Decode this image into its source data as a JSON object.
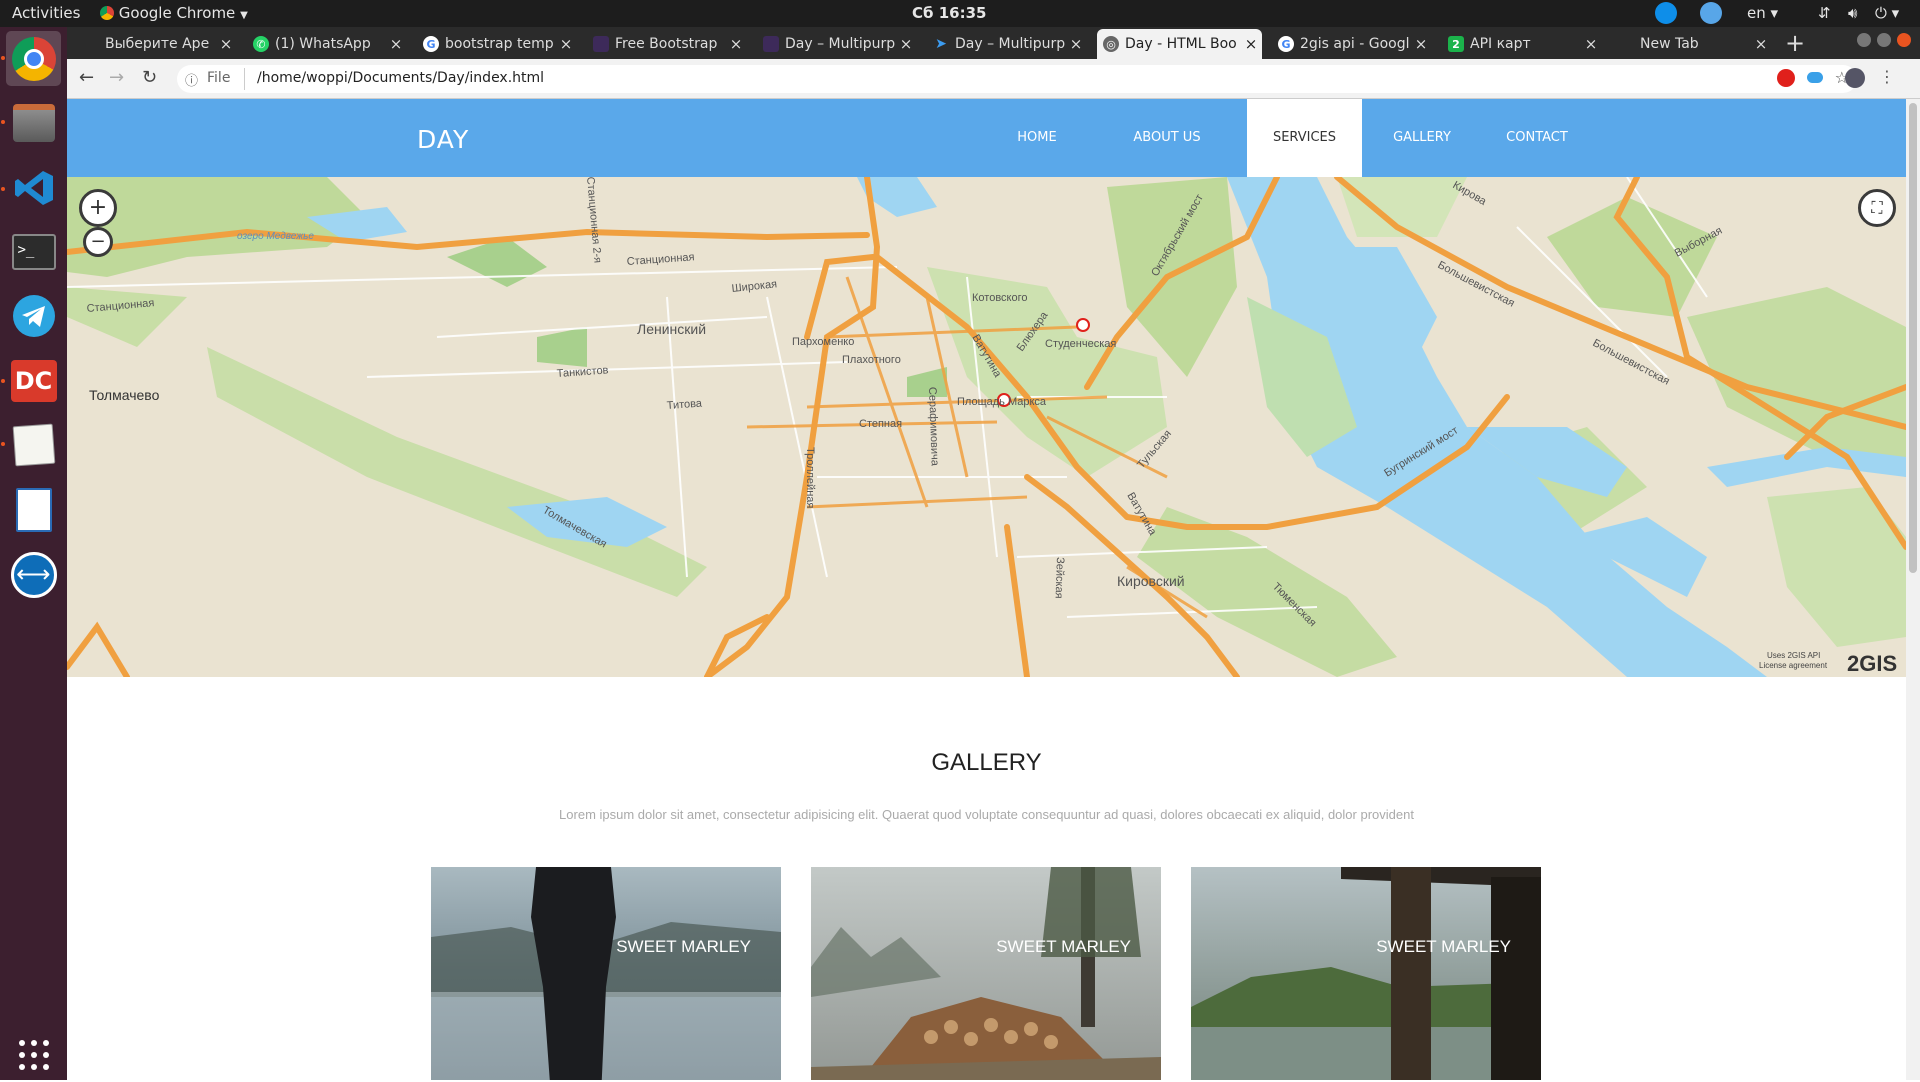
{
  "system": {
    "activities": "Activities",
    "app_name": "Google Chrome",
    "clock": "Сб 16:35",
    "language": "en"
  },
  "tabs": [
    {
      "title": "Выберите Аре",
      "favicon": "blank"
    },
    {
      "title": "(1) WhatsApp",
      "favicon": "whatsapp"
    },
    {
      "title": "bootstrap temp",
      "favicon": "google"
    },
    {
      "title": "Free Bootstrap",
      "favicon": "page"
    },
    {
      "title": "Day – Multipurp",
      "favicon": "page"
    },
    {
      "title": "Day – Multipurp",
      "favicon": "blue-arrow"
    },
    {
      "title": "Day - HTML Boo",
      "favicon": "globe",
      "active": true
    },
    {
      "title": "2gis api - Googl",
      "favicon": "google"
    },
    {
      "title": "API карт",
      "favicon": "2gis"
    },
    {
      "title": "New Tab",
      "favicon": "none"
    }
  ],
  "address": {
    "scheme_label": "File",
    "url": "/home/woppi/Documents/Day/index.html"
  },
  "site": {
    "brand": "DAY",
    "nav": [
      "HOME",
      "ABOUT US",
      "SERVICES",
      "GALLERY",
      "CONTACT"
    ],
    "active_nav": "SERVICES"
  },
  "map": {
    "zoom_in": "+",
    "zoom_out": "−",
    "labels": {
      "lake": "озеро Медвежье",
      "station1": "Станционная",
      "station2": "Станционная",
      "shirokaya": "Широкая",
      "leninsky": "Ленинский",
      "parkhomenko": "Пархоменко",
      "plakhotnogo": "Плахотного",
      "tankistov": "Танкистов",
      "titova": "Титова",
      "tolmachevo": "Толмачево",
      "stepnaya": "Степная",
      "serafimovicha": "Серафимовича",
      "troleynaya": "Троллейная",
      "tolmachevskaya": "Толмачевская",
      "kotovskogo": "Котовского",
      "blyukhera": "Блюхера",
      "studencheskaya": "Студенческая",
      "vatutina1": "Ватутина",
      "vatutina2": "Ватутина",
      "ploshchad": "Площадь Маркса",
      "tulskaya": "Тульская",
      "kirovsky": "Кировский",
      "tyumenskaya": "Тюменская",
      "bugrinsky": "Бугринский мост",
      "oktyabrsky": "Октябрьский мост",
      "bolshevistskaya1": "Большевистская",
      "bolshevistskaya2": "Большевистская",
      "vybornaya": "Выборная",
      "kirova": "Кирова",
      "station_vert": "Станционная 2-я",
      "vert2": "Зейская"
    },
    "attribution_line1": "Uses 2GIS API",
    "attribution_line2": "License agreement",
    "logo": "2GIS"
  },
  "gallery": {
    "title": "GALLERY",
    "subtitle": "Lorem ipsum dolor sit amet, consectetur adipisicing elit. Quaerat quod voluptate consequuntur ad quasi, dolores obcaecati ex aliquid, dolor provident",
    "items": [
      {
        "caption": "SWEET MARLEY"
      },
      {
        "caption": "SWEET MARLEY"
      },
      {
        "caption": "SWEET MARLEY"
      }
    ]
  }
}
